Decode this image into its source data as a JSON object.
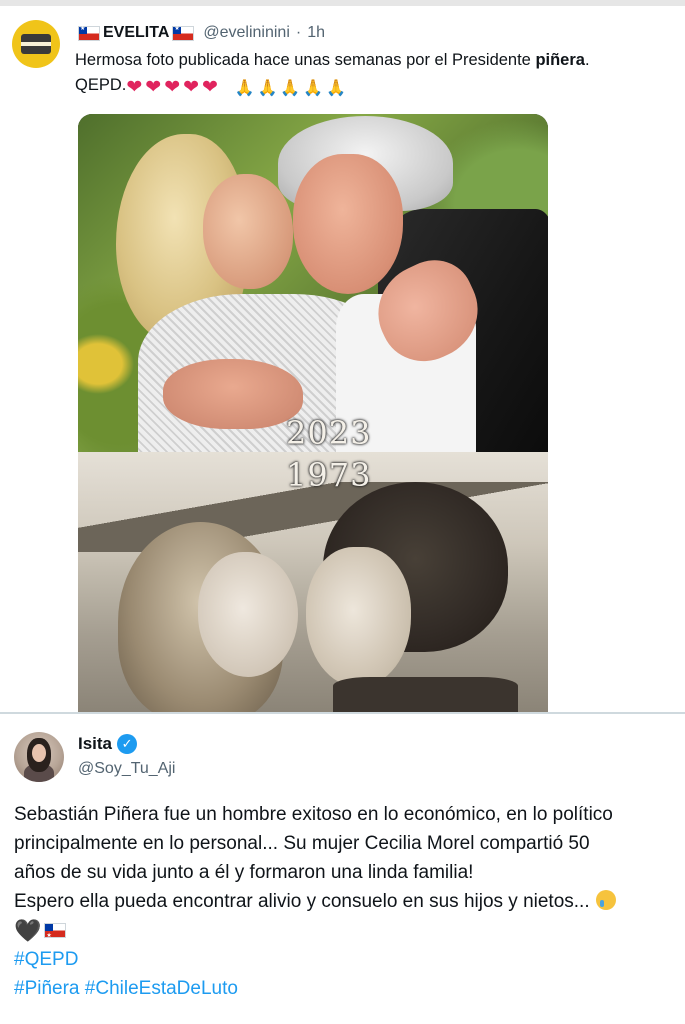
{
  "tweet1": {
    "display_name": "EVELITA",
    "handle": "@evelininini",
    "separator": "·",
    "time": "1h",
    "text_before_bold": "Hermosa foto publicada hace unas semanas  por el Presidente ",
    "text_bold": "piñera",
    "text_after_bold": ".",
    "text_line2": "QEPD.",
    "hearts": [
      "❤",
      "❤",
      "❤",
      "❤",
      "❤"
    ],
    "prays": [
      "🙏",
      "🙏",
      "🙏",
      "🙏",
      "🙏"
    ],
    "photo_years": {
      "top": "2023",
      "bottom": "1973"
    }
  },
  "tweet2": {
    "display_name": "Isita",
    "verified_mark": "✓",
    "handle": "@Soy_Tu_Aji",
    "lines": [
      "Sebastián Piñera fue un hombre exitoso en lo económico, en lo político",
      "principalmente en lo personal... Su mujer Cecilia Morel compartió 50",
      "años de su vida junto a él y formaron una linda familia!",
      "Espero ella pueda encontrar alivio y consuelo en sus hijos y nietos..."
    ],
    "black_heart": "🖤",
    "hashtags_line1": [
      "#QEPD"
    ],
    "hashtags_line2": [
      "#Piñera",
      "#ChileEstaDeLuto"
    ]
  },
  "colors": {
    "text": "#0f1419",
    "secondary": "#536471",
    "link": "#1d9bf0",
    "heart": "#e0245e",
    "divider": "#cfd9de"
  }
}
